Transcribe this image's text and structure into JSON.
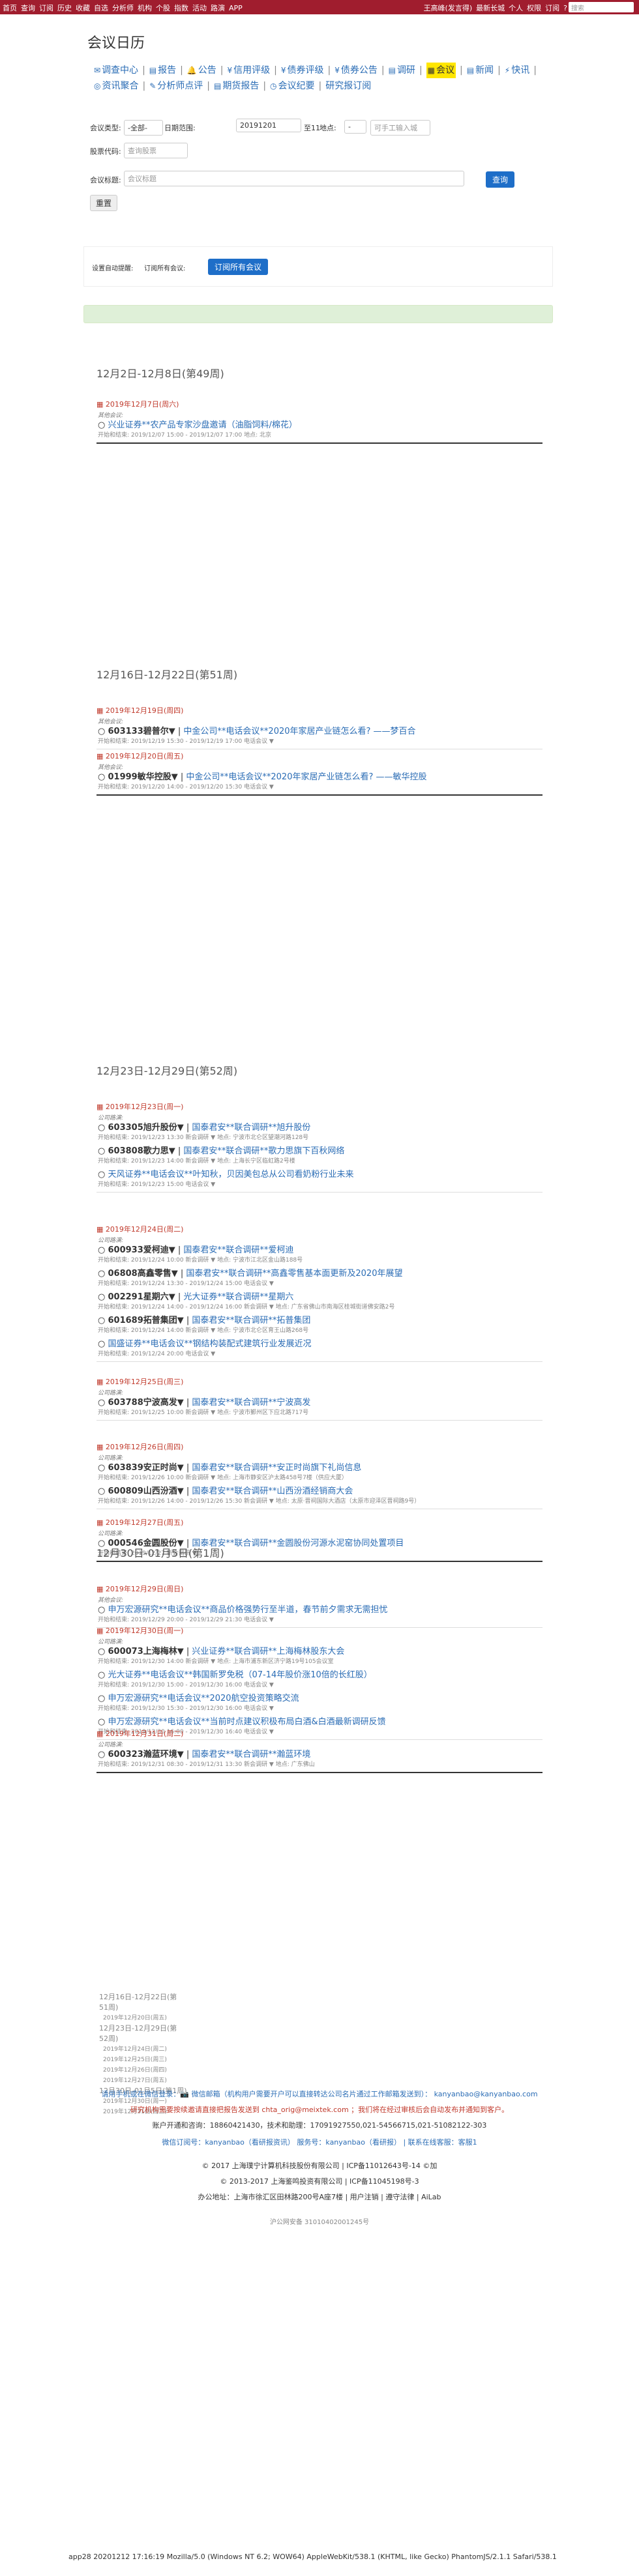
{
  "topbar": {
    "left": [
      "首页",
      "查询",
      "订阅",
      "历史",
      "收藏",
      "自选",
      "分析师",
      "机构",
      "个股",
      "指数",
      "活动",
      "路演",
      "APP"
    ],
    "right": [
      "王高峰(发言得)",
      "最新长城",
      "个人",
      "权限",
      "订阅",
      "?"
    ],
    "search_placeholder": "搜索"
  },
  "page_title": "会议日历",
  "nav": [
    {
      "label": "调查中心",
      "icon": "envelope-icon",
      "glyph": "✉"
    },
    {
      "label": "报告",
      "icon": "doc-icon",
      "glyph": "▤"
    },
    {
      "label": "公告",
      "icon": "bell-icon",
      "glyph": "🔔"
    },
    {
      "label": "信用评级",
      "icon": "yen-icon",
      "glyph": "¥"
    },
    {
      "label": "债券评级",
      "icon": "yen-icon",
      "glyph": "¥"
    },
    {
      "label": "债券公告",
      "icon": "yen-icon",
      "glyph": "¥"
    },
    {
      "label": "调研",
      "icon": "doc-icon",
      "glyph": "▤"
    },
    {
      "label": "会议",
      "icon": "calendar-icon",
      "glyph": "▦",
      "active": true
    },
    {
      "label": "新闻",
      "icon": "news-icon",
      "glyph": "▤"
    },
    {
      "label": "快讯",
      "icon": "bolt-icon",
      "glyph": "⚡"
    },
    {
      "label": "资讯聚合",
      "icon": "globe-icon",
      "glyph": "◎"
    },
    {
      "label": "分析师点评",
      "icon": "chat-icon",
      "glyph": "✎"
    },
    {
      "label": "期货报告",
      "icon": "doc-icon",
      "glyph": "▤"
    },
    {
      "label": "会议纪要",
      "icon": "clock-icon",
      "glyph": "◷"
    },
    {
      "label": "研究报订阅",
      "icon": "",
      "glyph": ""
    }
  ],
  "filter": {
    "type_label": "会议类型:",
    "type_value": "-全部-",
    "date_label": "日期范围:",
    "date_value": "20191201",
    "date_to": "至11",
    "place_label": "地点:",
    "place_value": "-",
    "place_placeholder": "可手工输入城",
    "stock_label": "股票代码:",
    "stock_placeholder": "查询股票",
    "name_label": "会议标题:",
    "name_placeholder": "会议标题",
    "search_btn": "查询",
    "reset_btn": "重置"
  },
  "subscribe": {
    "label": "设置自动提醒:",
    "text": "订阅所有会议:",
    "btn": "订阅所有会议"
  },
  "weeks": [
    {
      "title": "12月2日-12月8日(第49周)",
      "days": [
        {
          "date": "2019年12月7日(周六)",
          "items": [
            {
              "cat": "其他会议:",
              "title": "兴业证券**农产品专家沙盘邀请（油脂饲料/棉花）",
              "time": "开始和结束: 2019/12/07 15:00 - 2019/12/07 17:00 地点: 北京"
            }
          ]
        }
      ]
    },
    {
      "title": "12月16日-12月22日(第51周)",
      "days": [
        {
          "date": "2019年12月19日(周四)",
          "items": [
            {
              "cat": "其他会议:",
              "stock": "603133碧普尔▼",
              "title": "中金公司**电话会议**2020年家居产业链怎么看? ——梦百合",
              "time": "开始和结束: 2019/12/19 15:30 - 2019/12/19 17:00 电话会议 ▼"
            }
          ]
        },
        {
          "date": "2019年12月20日(周五)",
          "items": [
            {
              "cat": "其他会议:",
              "stock": "01999敏华控股▼",
              "title": "中金公司**电话会议**2020年家居产业链怎么看? ——敏华控股",
              "time": "开始和结束: 2019/12/20 14:00 - 2019/12/20 15:30 电话会议 ▼"
            }
          ]
        }
      ]
    },
    {
      "title": "12月23日-12月29日(第52周)",
      "days": [
        {
          "date": "2019年12月23日(周一)",
          "items": [
            {
              "cat": "公司路演:",
              "stock": "603305旭升股份▼",
              "title": "国泰君安**联合调研**旭升股份",
              "time": "开始和结束: 2019/12/23 13:30 新会调研 ▼ 地点: 宁波市北仑区望潮河路128号"
            },
            {
              "stock": "603808歌力思▼",
              "title": "国泰君安**联合调研**歌力思旗下百秋网络",
              "time": "开始和结束: 2019/12/23 14:00 新会调研 ▼ 地点: 上海长宁区临虹路2号楼"
            },
            {
              "title": "天风证券**电话会议**叶知秋，贝因美包总从公司看奶粉行业未来",
              "time": "开始和结束: 2019/12/23 15:00 电话会议 ▼"
            }
          ]
        },
        {
          "date": "2019年12月24日(周二)",
          "items": [
            {
              "cat": "公司路演:",
              "stock": "600933爱柯迪▼",
              "title": "国泰君安**联合调研**爱柯迪",
              "time": "开始和结束: 2019/12/24 10:00 新会调研 ▼ 地点: 宁波市江北区金山路188号"
            },
            {
              "stock": "06808高鑫零售▼",
              "title": "国泰君安**联合调研**高鑫零售基本面更新及2020年展望",
              "time": "开始和结束: 2019/12/24 13:30 - 2019/12/24 15:00 电话会议 ▼"
            },
            {
              "stock": "002291星期六▼",
              "title": "光大证券**联合调研**星期六",
              "time": "开始和结束: 2019/12/24 14:00 - 2019/12/24 16:00 新会调研 ▼ 地点: 广东省佛山市南海区桂城街道佛安路2号"
            },
            {
              "stock": "601689拓普集团▼",
              "title": "国泰君安**联合调研**拓普集团",
              "time": "开始和结束: 2019/12/24 14:00 新会调研 ▼ 地点: 宁波市北仑区育王山路268号"
            },
            {
              "title": "国盛证券**电话会议**钢结构装配式建筑行业发展近况",
              "time": "开始和结束: 2019/12/24 20:00 电话会议 ▼"
            }
          ]
        },
        {
          "date": "2019年12月25日(周三)",
          "items": [
            {
              "cat": "公司路演:",
              "stock": "603788宁波高发▼",
              "title": "国泰君安**联合调研**宁波高发",
              "time": "开始和结束: 2019/12/25 10:00 新会调研 ▼ 地点: 宁波市鄞州区下应北路717号"
            }
          ]
        },
        {
          "date": "2019年12月26日(周四)",
          "items": [
            {
              "cat": "公司路演:",
              "stock": "603839安正时尚▼",
              "title": "国泰君安**联合调研**安正时尚旗下礼尚信息",
              "time": "开始和结束: 2019/12/26 10:00 新会调研 ▼ 地点: 上海市静安区沪太路458号7楼（供应大厦）"
            },
            {
              "stock": "600809山西汾酒▼",
              "title": "国泰君安**联合调研**山西汾酒经销商大会",
              "time": "开始和结束: 2019/12/26 14:00 - 2019/12/26 15:30 新会调研 ▼ 地点: 太原·晋祠国际大酒店（太原市迎泽区晋祠路9号）"
            }
          ]
        },
        {
          "date": "2019年12月27日(周五)",
          "items": [
            {
              "cat": "公司路演:",
              "stock": "000546金圆股份▼",
              "title": "国泰君安**联合调研**金圆股份河源水泥窑协同处置项目",
              "time": "开始和结束: 2019/12/27 新会调研 ▼"
            }
          ]
        }
      ]
    },
    {
      "title": "12月30日-01月5日(第1周)",
      "days": [
        {
          "date": "2019年12月29日(周日)",
          "items": [
            {
              "cat": "其他会议:",
              "title": "申万宏源研究**电话会议**商品价格强势行至半道，春节前夕需求无需担忧",
              "time": "开始和结束: 2019/12/29 20:00 - 2019/12/29 21:30 电话会议 ▼"
            }
          ]
        },
        {
          "date": "2019年12月30日(周一)",
          "items": [
            {
              "cat": "公司路演:",
              "stock": "600073上海梅林▼",
              "title": "兴业证券**联合调研**上海梅林股东大会",
              "time": "开始和结束: 2019/12/30 14:00 新会调研 ▼ 地点: 上海市浦东新区济宁路19号105会议室"
            },
            {
              "title": "光大证券**电话会议**韩国新罗免税（07-14年股价涨10倍的长红股）",
              "time": "开始和结束: 2019/12/30 15:00 - 2019/12/30 16:00 电话会议 ▼"
            },
            {
              "title": "申万宏源研究**电话会议**2020航空投资策略交流",
              "time": "开始和结束: 2019/12/30 15:30 - 2019/12/30 16:00 电话会议 ▼"
            },
            {
              "title": "申万宏源研究**电话会议**当前时点建议积极布局白酒&白酒最新调研反馈",
              "time": "开始和结束: 2019/12/30 16:00 - 2019/12/30 16:40 电话会议 ▼"
            }
          ]
        },
        {
          "date": "2019年12月31日(周二)",
          "items": [
            {
              "cat": "公司路演:",
              "stock": "600323瀚蓝环境▼",
              "title": "国泰君安**联合调研**瀚蓝环境",
              "time": "开始和结束: 2019/12/31 08:30 - 2019/12/31 13:30 新会调研 ▼ 地点: 广东佛山"
            }
          ]
        }
      ]
    }
  ],
  "recent": [
    {
      "t": "12月16日-12月22日(第",
      "s": false
    },
    {
      "t": "51周)",
      "s": false
    },
    {
      "t": "2019年12月20日(周五)",
      "s": true
    },
    {
      "t": "12月23日-12月29日(第",
      "s": false
    },
    {
      "t": "52周)",
      "s": false
    },
    {
      "t": "2019年12月24日(周二)",
      "s": true
    },
    {
      "t": "2019年12月25日(周三)",
      "s": true
    },
    {
      "t": "2019年12月26日(周四)",
      "s": true
    },
    {
      "t": "2019年12月27日(周五)",
      "s": true
    },
    {
      "t": "12月30日-01月5日(第1周)",
      "s": false
    },
    {
      "t": "2019年12月30日(周一)",
      "s": true
    },
    {
      "t": "2019年12月31日(周二)",
      "s": true
    }
  ],
  "footer": {
    "l1": "请用手机或在微信登录：📷 微信邮箱（机构用户需要开户可以直接转达公司名片通过工作邮箱发送到）： kanyanbao@kanyanbao.com",
    "l2": "研究机构需要按续邀请直接把报告发送到 chta_orig@meixtek.com ；我们将在经过审核后会自动发布并通知到客户。",
    "l3": "账户开通和咨询：18860421430，技术和助理：17091927550,021-54566715,021-51082122-303",
    "l4": "微信订阅号：kanyanbao（看研报资讯） 服务号：kanyanbao（看研报） | 联系在线客服：客服1",
    "l5": "© 2017 上海璞宁计算机科技股份有限公司 | ICP备11012643号-14 ©加",
    "l6": "© 2013-2017 上海鉴鸣投资有限公司 | ICP备11045198号-3",
    "l7": "办公地址：上海市徐汇区田林路200号A座7楼 | 用户注销 | 遵守法律 | AiLab",
    "l8": "沪公网安备 31010402001245号"
  },
  "ua": "app28 20201212 17:16:19 Mozilla/5.0 (Windows NT 6.2; WOW64) AppleWebKit/538.1 (KHTML, like Gecko) PhantomJS/2.1.1 Safari/538.1"
}
